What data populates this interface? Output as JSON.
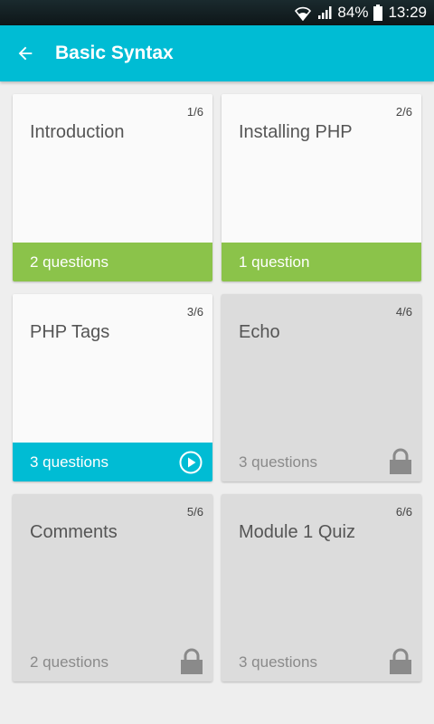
{
  "status_bar": {
    "battery_percent": "84%",
    "time": "13:29",
    "icons": [
      "wifi-icon",
      "signal-icon",
      "battery-icon"
    ]
  },
  "app_bar": {
    "title": "Basic Syntax",
    "back_icon": "arrow-left-icon"
  },
  "lessons": [
    {
      "title": "Introduction",
      "index": "1/6",
      "footer": "2 questions",
      "state": "completed"
    },
    {
      "title": "Installing PHP",
      "index": "2/6",
      "footer": "1 question",
      "state": "completed"
    },
    {
      "title": "PHP Tags",
      "index": "3/6",
      "footer": "3 questions",
      "state": "current"
    },
    {
      "title": "Echo",
      "index": "4/6",
      "footer": "3 questions",
      "state": "locked"
    },
    {
      "title": "Comments",
      "index": "5/6",
      "footer": "2 questions",
      "state": "locked"
    },
    {
      "title": "Module 1 Quiz",
      "index": "6/6",
      "footer": "3 questions",
      "state": "locked"
    }
  ],
  "colors": {
    "primary": "#00bcd4",
    "completed": "#8bc34a",
    "locked_card": "#dcdcdc",
    "background": "#eeeeee"
  }
}
